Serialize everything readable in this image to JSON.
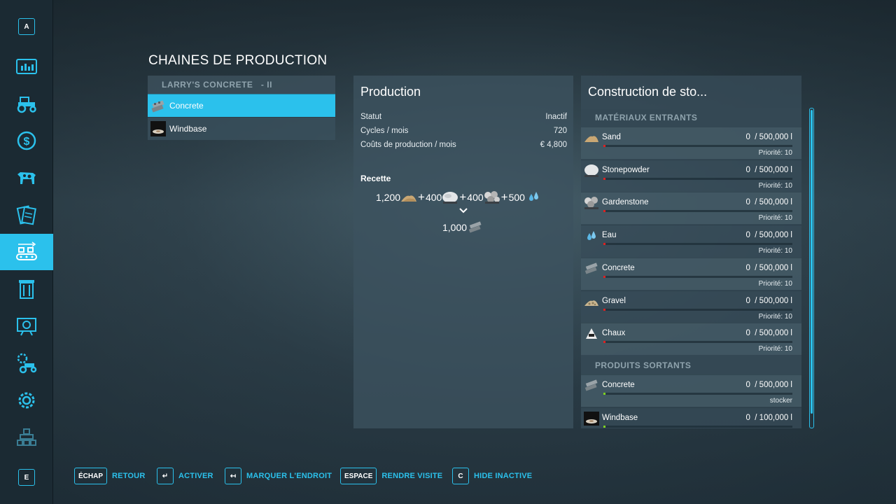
{
  "colors": {
    "accent": "#2bc1ec",
    "fill_red": "#e02020",
    "fill_green": "#7ed321"
  },
  "sidebar": {
    "top_key": "A",
    "bottom_key": "E",
    "items": [
      {
        "icon": "stats-icon"
      },
      {
        "icon": "tractor-icon"
      },
      {
        "icon": "finance-icon"
      },
      {
        "icon": "animals-icon"
      },
      {
        "icon": "contracts-icon"
      },
      {
        "icon": "production-icon",
        "active": true
      },
      {
        "icon": "silo-icon"
      },
      {
        "icon": "tutorial-icon"
      },
      {
        "icon": "vehicle-settings-icon"
      },
      {
        "icon": "settings-icon"
      },
      {
        "icon": "hierarchy-icon"
      }
    ]
  },
  "page": {
    "title": "CHAINES DE PRODUCTION"
  },
  "production_list": {
    "header": "LARRY'S CONCRETE   - II",
    "items": [
      {
        "label": "Concrete",
        "icon": "concrete-icon",
        "selected": true
      },
      {
        "label": "Windbase",
        "icon": "windbase-icon",
        "selected": false
      }
    ]
  },
  "production": {
    "title": "Production",
    "stats": [
      {
        "label": "Statut",
        "value": "Inactif"
      },
      {
        "label": "Cycles / mois",
        "value": "720"
      },
      {
        "label": "Coûts de production / mois",
        "value": "€ 4,800"
      }
    ],
    "recipe_label": "Recette",
    "inputs": [
      {
        "amount": "1,200",
        "icon": "sand-icon"
      },
      {
        "amount": "400",
        "icon": "stonepowder-icon"
      },
      {
        "amount": "400",
        "icon": "gardenstone-icon"
      },
      {
        "amount": "500",
        "icon": "water-icon"
      }
    ],
    "plus": "+",
    "output": {
      "amount": "1,000",
      "icon": "concrete-icon"
    }
  },
  "storage": {
    "title": "Construction de sto...",
    "inputs_header": "MATÉRIAUX ENTRANTS",
    "outputs_header": "PRODUITS SORTANTS",
    "inputs": [
      {
        "name": "Sand",
        "icon": "sand-icon",
        "amount": "0",
        "capacity": "/ 500,000 l",
        "note": "Priorité: 10",
        "fill_fraction": 0
      },
      {
        "name": "Stonepowder",
        "icon": "stonepowder-icon",
        "amount": "0",
        "capacity": "/ 500,000 l",
        "note": "Priorité: 10",
        "fill_fraction": 0
      },
      {
        "name": "Gardenstone",
        "icon": "gardenstone-icon",
        "amount": "0",
        "capacity": "/ 500,000 l",
        "note": "Priorité: 10",
        "fill_fraction": 0
      },
      {
        "name": "Eau",
        "icon": "water-icon",
        "amount": "0",
        "capacity": "/ 500,000 l",
        "note": "Priorité: 10",
        "fill_fraction": 0
      },
      {
        "name": "Concrete",
        "icon": "concrete-icon",
        "amount": "0",
        "capacity": "/ 500,000 l",
        "note": "Priorité: 10",
        "fill_fraction": 0
      },
      {
        "name": "Gravel",
        "icon": "gravel-icon",
        "amount": "0",
        "capacity": "/ 500,000 l",
        "note": "Priorité: 10",
        "fill_fraction": 0
      },
      {
        "name": "Chaux",
        "icon": "lime-icon",
        "amount": "0",
        "capacity": "/ 500,000 l",
        "note": "Priorité: 10",
        "fill_fraction": 0
      }
    ],
    "outputs": [
      {
        "name": "Concrete",
        "icon": "concrete-icon",
        "amount": "0",
        "capacity": "/ 500,000 l",
        "note": "stocker",
        "fill_fraction": 0
      },
      {
        "name": "Windbase",
        "icon": "windbase-icon",
        "amount": "0",
        "capacity": "/ 100,000 l",
        "note": "",
        "fill_fraction": 0
      }
    ]
  },
  "hints": [
    {
      "key": "ÉCHAP",
      "label": "RETOUR"
    },
    {
      "key": "↵",
      "label": "ACTIVER"
    },
    {
      "key": "↤",
      "label": "MARQUER L'ENDROIT"
    },
    {
      "key": "ESPACE",
      "label": "RENDRE VISITE"
    },
    {
      "key": "C",
      "label": "HIDE INACTIVE"
    }
  ]
}
